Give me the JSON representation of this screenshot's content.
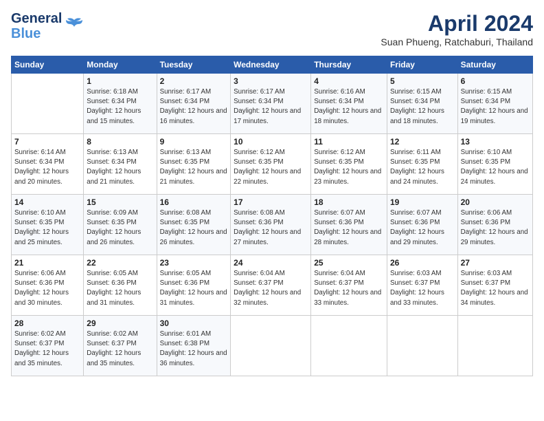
{
  "logo": {
    "line1": "General",
    "line2": "Blue"
  },
  "title": "April 2024",
  "location": "Suan Phueng, Ratchaburi, Thailand",
  "weekdays": [
    "Sunday",
    "Monday",
    "Tuesday",
    "Wednesday",
    "Thursday",
    "Friday",
    "Saturday"
  ],
  "weeks": [
    [
      null,
      {
        "day": "1",
        "sunrise": "6:18 AM",
        "sunset": "6:34 PM",
        "daylight": "12 hours and 15 minutes."
      },
      {
        "day": "2",
        "sunrise": "6:17 AM",
        "sunset": "6:34 PM",
        "daylight": "12 hours and 16 minutes."
      },
      {
        "day": "3",
        "sunrise": "6:17 AM",
        "sunset": "6:34 PM",
        "daylight": "12 hours and 17 minutes."
      },
      {
        "day": "4",
        "sunrise": "6:16 AM",
        "sunset": "6:34 PM",
        "daylight": "12 hours and 18 minutes."
      },
      {
        "day": "5",
        "sunrise": "6:15 AM",
        "sunset": "6:34 PM",
        "daylight": "12 hours and 18 minutes."
      },
      {
        "day": "6",
        "sunrise": "6:15 AM",
        "sunset": "6:34 PM",
        "daylight": "12 hours and 19 minutes."
      }
    ],
    [
      {
        "day": "7",
        "sunrise": "6:14 AM",
        "sunset": "6:34 PM",
        "daylight": "12 hours and 20 minutes."
      },
      {
        "day": "8",
        "sunrise": "6:13 AM",
        "sunset": "6:34 PM",
        "daylight": "12 hours and 21 minutes."
      },
      {
        "day": "9",
        "sunrise": "6:13 AM",
        "sunset": "6:35 PM",
        "daylight": "12 hours and 21 minutes."
      },
      {
        "day": "10",
        "sunrise": "6:12 AM",
        "sunset": "6:35 PM",
        "daylight": "12 hours and 22 minutes."
      },
      {
        "day": "11",
        "sunrise": "6:12 AM",
        "sunset": "6:35 PM",
        "daylight": "12 hours and 23 minutes."
      },
      {
        "day": "12",
        "sunrise": "6:11 AM",
        "sunset": "6:35 PM",
        "daylight": "12 hours and 24 minutes."
      },
      {
        "day": "13",
        "sunrise": "6:10 AM",
        "sunset": "6:35 PM",
        "daylight": "12 hours and 24 minutes."
      }
    ],
    [
      {
        "day": "14",
        "sunrise": "6:10 AM",
        "sunset": "6:35 PM",
        "daylight": "12 hours and 25 minutes."
      },
      {
        "day": "15",
        "sunrise": "6:09 AM",
        "sunset": "6:35 PM",
        "daylight": "12 hours and 26 minutes."
      },
      {
        "day": "16",
        "sunrise": "6:08 AM",
        "sunset": "6:35 PM",
        "daylight": "12 hours and 26 minutes."
      },
      {
        "day": "17",
        "sunrise": "6:08 AM",
        "sunset": "6:36 PM",
        "daylight": "12 hours and 27 minutes."
      },
      {
        "day": "18",
        "sunrise": "6:07 AM",
        "sunset": "6:36 PM",
        "daylight": "12 hours and 28 minutes."
      },
      {
        "day": "19",
        "sunrise": "6:07 AM",
        "sunset": "6:36 PM",
        "daylight": "12 hours and 29 minutes."
      },
      {
        "day": "20",
        "sunrise": "6:06 AM",
        "sunset": "6:36 PM",
        "daylight": "12 hours and 29 minutes."
      }
    ],
    [
      {
        "day": "21",
        "sunrise": "6:06 AM",
        "sunset": "6:36 PM",
        "daylight": "12 hours and 30 minutes."
      },
      {
        "day": "22",
        "sunrise": "6:05 AM",
        "sunset": "6:36 PM",
        "daylight": "12 hours and 31 minutes."
      },
      {
        "day": "23",
        "sunrise": "6:05 AM",
        "sunset": "6:36 PM",
        "daylight": "12 hours and 31 minutes."
      },
      {
        "day": "24",
        "sunrise": "6:04 AM",
        "sunset": "6:37 PM",
        "daylight": "12 hours and 32 minutes."
      },
      {
        "day": "25",
        "sunrise": "6:04 AM",
        "sunset": "6:37 PM",
        "daylight": "12 hours and 33 minutes."
      },
      {
        "day": "26",
        "sunrise": "6:03 AM",
        "sunset": "6:37 PM",
        "daylight": "12 hours and 33 minutes."
      },
      {
        "day": "27",
        "sunrise": "6:03 AM",
        "sunset": "6:37 PM",
        "daylight": "12 hours and 34 minutes."
      }
    ],
    [
      {
        "day": "28",
        "sunrise": "6:02 AM",
        "sunset": "6:37 PM",
        "daylight": "12 hours and 35 minutes."
      },
      {
        "day": "29",
        "sunrise": "6:02 AM",
        "sunset": "6:37 PM",
        "daylight": "12 hours and 35 minutes."
      },
      {
        "day": "30",
        "sunrise": "6:01 AM",
        "sunset": "6:38 PM",
        "daylight": "12 hours and 36 minutes."
      },
      null,
      null,
      null,
      null
    ]
  ],
  "labels": {
    "sunrise_prefix": "Sunrise: ",
    "sunset_prefix": "Sunset: ",
    "daylight_prefix": "Daylight: "
  }
}
